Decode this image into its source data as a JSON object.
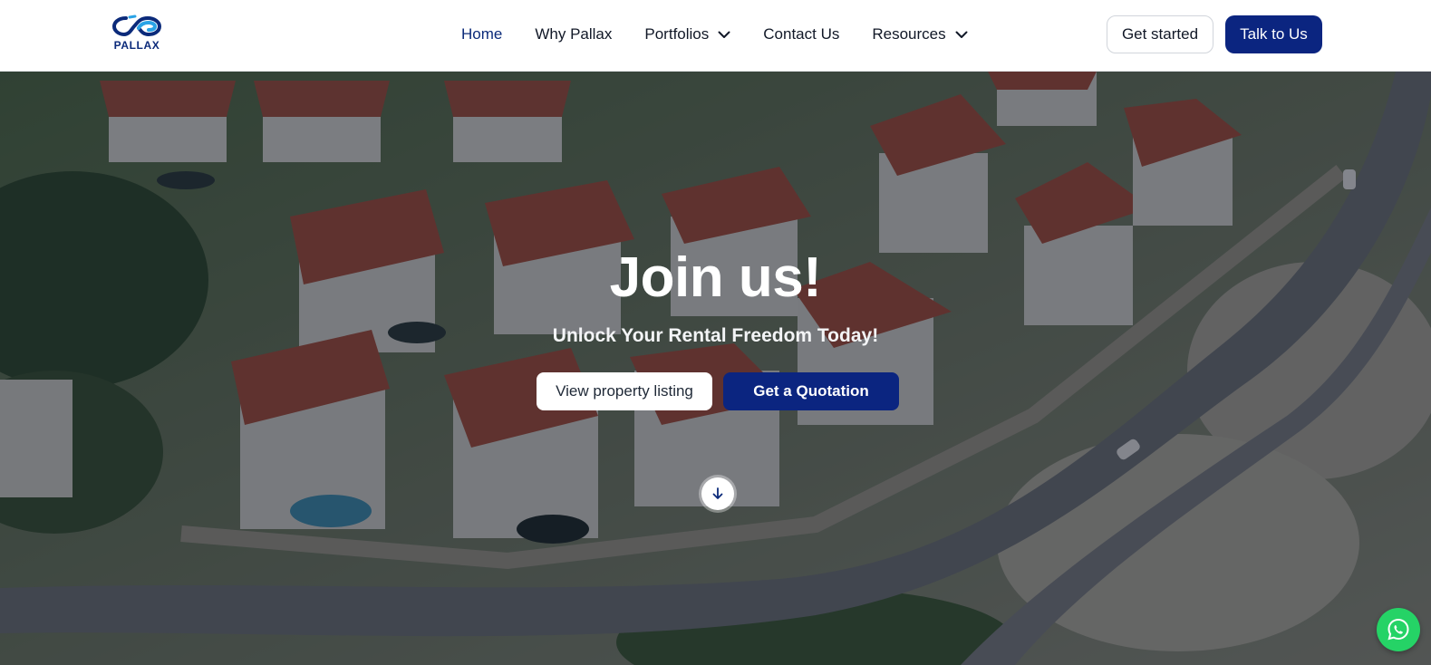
{
  "brand": {
    "logo_text": "PALLAX",
    "logo_icon": "infinity-icon",
    "color": "#0b2a7a",
    "accent": "#2aa3e6"
  },
  "nav": {
    "items": [
      {
        "label": "Home",
        "active": true
      },
      {
        "label": "Why Pallax",
        "active": false
      },
      {
        "label": "Portfolios",
        "dropdown": true
      },
      {
        "label": "Contact Us",
        "active": false
      },
      {
        "label": "Resources",
        "dropdown": true
      }
    ]
  },
  "header_actions": {
    "get_started": "Get started",
    "talk_to_us": "Talk to Us"
  },
  "hero": {
    "title": "Join us!",
    "subtitle": "Unlock Your Rental Freedom Today!",
    "primary_cta": "Get a Quotation",
    "secondary_cta": "View property listing",
    "scroll_icon": "arrow-down-icon",
    "background": "aerial photo of villas with terracotta roofs on a hillside"
  },
  "floating": {
    "whatsapp_icon": "whatsapp-icon",
    "whatsapp_color": "#25d366"
  },
  "colors": {
    "primary": "#0b2580",
    "active_nav": "#0b2a7a"
  }
}
